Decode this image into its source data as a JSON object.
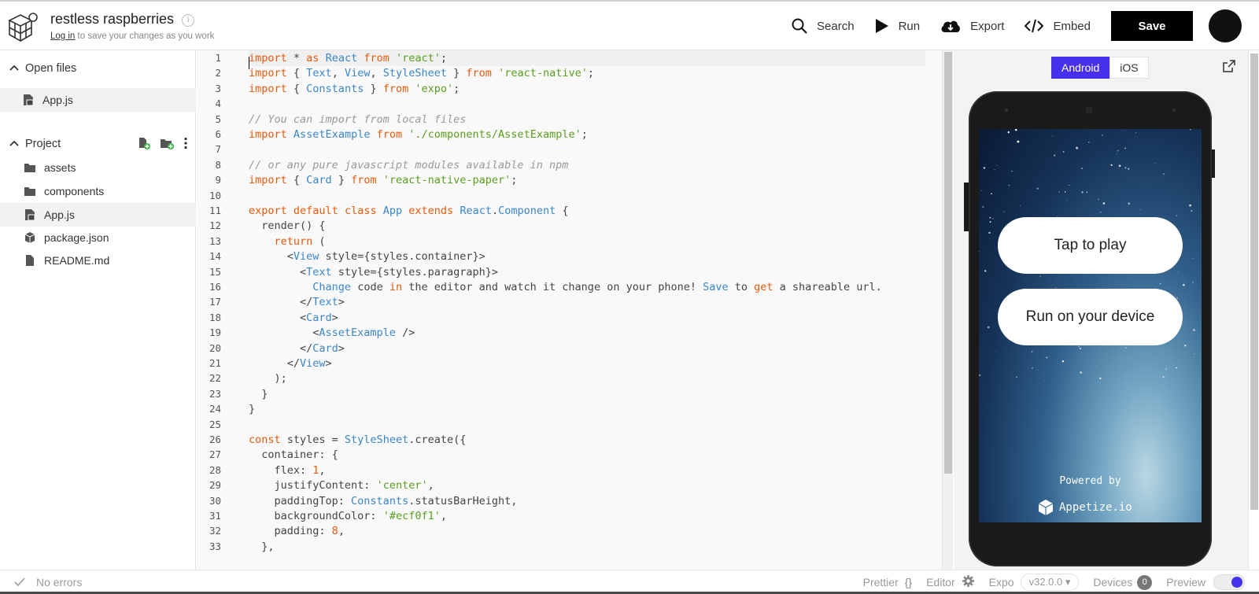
{
  "header": {
    "title": "restless raspberries",
    "login_link": "Log in",
    "login_suffix": " to save your changes as you work",
    "actions": {
      "search": "Search",
      "run": "Run",
      "export": "Export",
      "embed": "Embed"
    },
    "save_label": "Save"
  },
  "sidebar": {
    "open_files_title": "Open files",
    "open_files": [
      {
        "label": "App.js"
      }
    ],
    "project_title": "Project",
    "project_items": [
      {
        "label": "assets",
        "icon": "folder-icon"
      },
      {
        "label": "components",
        "icon": "folder-icon"
      },
      {
        "label": "App.js",
        "icon": "js-file-icon"
      },
      {
        "label": "package.json",
        "icon": "package-icon"
      },
      {
        "label": "README.md",
        "icon": "file-icon"
      }
    ]
  },
  "editor": {
    "line_numbers": [
      "1",
      "2",
      "3",
      "4",
      "5",
      "6",
      "7",
      "8",
      "9",
      "10",
      "11",
      "12",
      "13",
      "14",
      "15",
      "16",
      "17",
      "18",
      "19",
      "20",
      "21",
      "22",
      "23",
      "24",
      "25",
      "26",
      "27",
      "28",
      "29",
      "30",
      "31",
      "32",
      "33"
    ],
    "lines": [
      "import * as React from 'react';",
      "import { Text, View, StyleSheet } from 'react-native';",
      "import { Constants } from 'expo';",
      "",
      "// You can import from local files",
      "import AssetExample from './components/AssetExample';",
      "",
      "// or any pure javascript modules available in npm",
      "import { Card } from 'react-native-paper';",
      "",
      "export default class App extends React.Component {",
      "  render() {",
      "    return (",
      "      <View style={styles.container}>",
      "        <Text style={styles.paragraph}>",
      "          Change code in the editor and watch it change on your phone! Save to get a shareable url.",
      "        </Text>",
      "        <Card>",
      "          <AssetExample />",
      "        </Card>",
      "      </View>",
      "    );",
      "  }",
      "}",
      "",
      "const styles = StyleSheet.create({",
      "  container: {",
      "    flex: 1,",
      "    justifyContent: 'center',",
      "    paddingTop: Constants.statusBarHeight,",
      "    backgroundColor: '#ecf0f1',",
      "    padding: 8,",
      "  },"
    ]
  },
  "preview": {
    "platforms": [
      "Android",
      "iOS"
    ],
    "selected_platform": "Android",
    "tap_to_play": "Tap to play",
    "run_on_device": "Run on your device",
    "powered_by": "Powered by",
    "appetize": "Appetize.io"
  },
  "status": {
    "errors": "No errors",
    "prettier": "Prettier",
    "editor": "Editor",
    "expo": "Expo",
    "expo_version": "v32.0.0",
    "devices": "Devices",
    "devices_count": "0",
    "preview": "Preview"
  },
  "colors": {
    "accent": "#4630eb",
    "keyword": "#e8590c",
    "identifier": "#3a86c8",
    "string": "#5a9e1e",
    "comment": "#999999"
  }
}
